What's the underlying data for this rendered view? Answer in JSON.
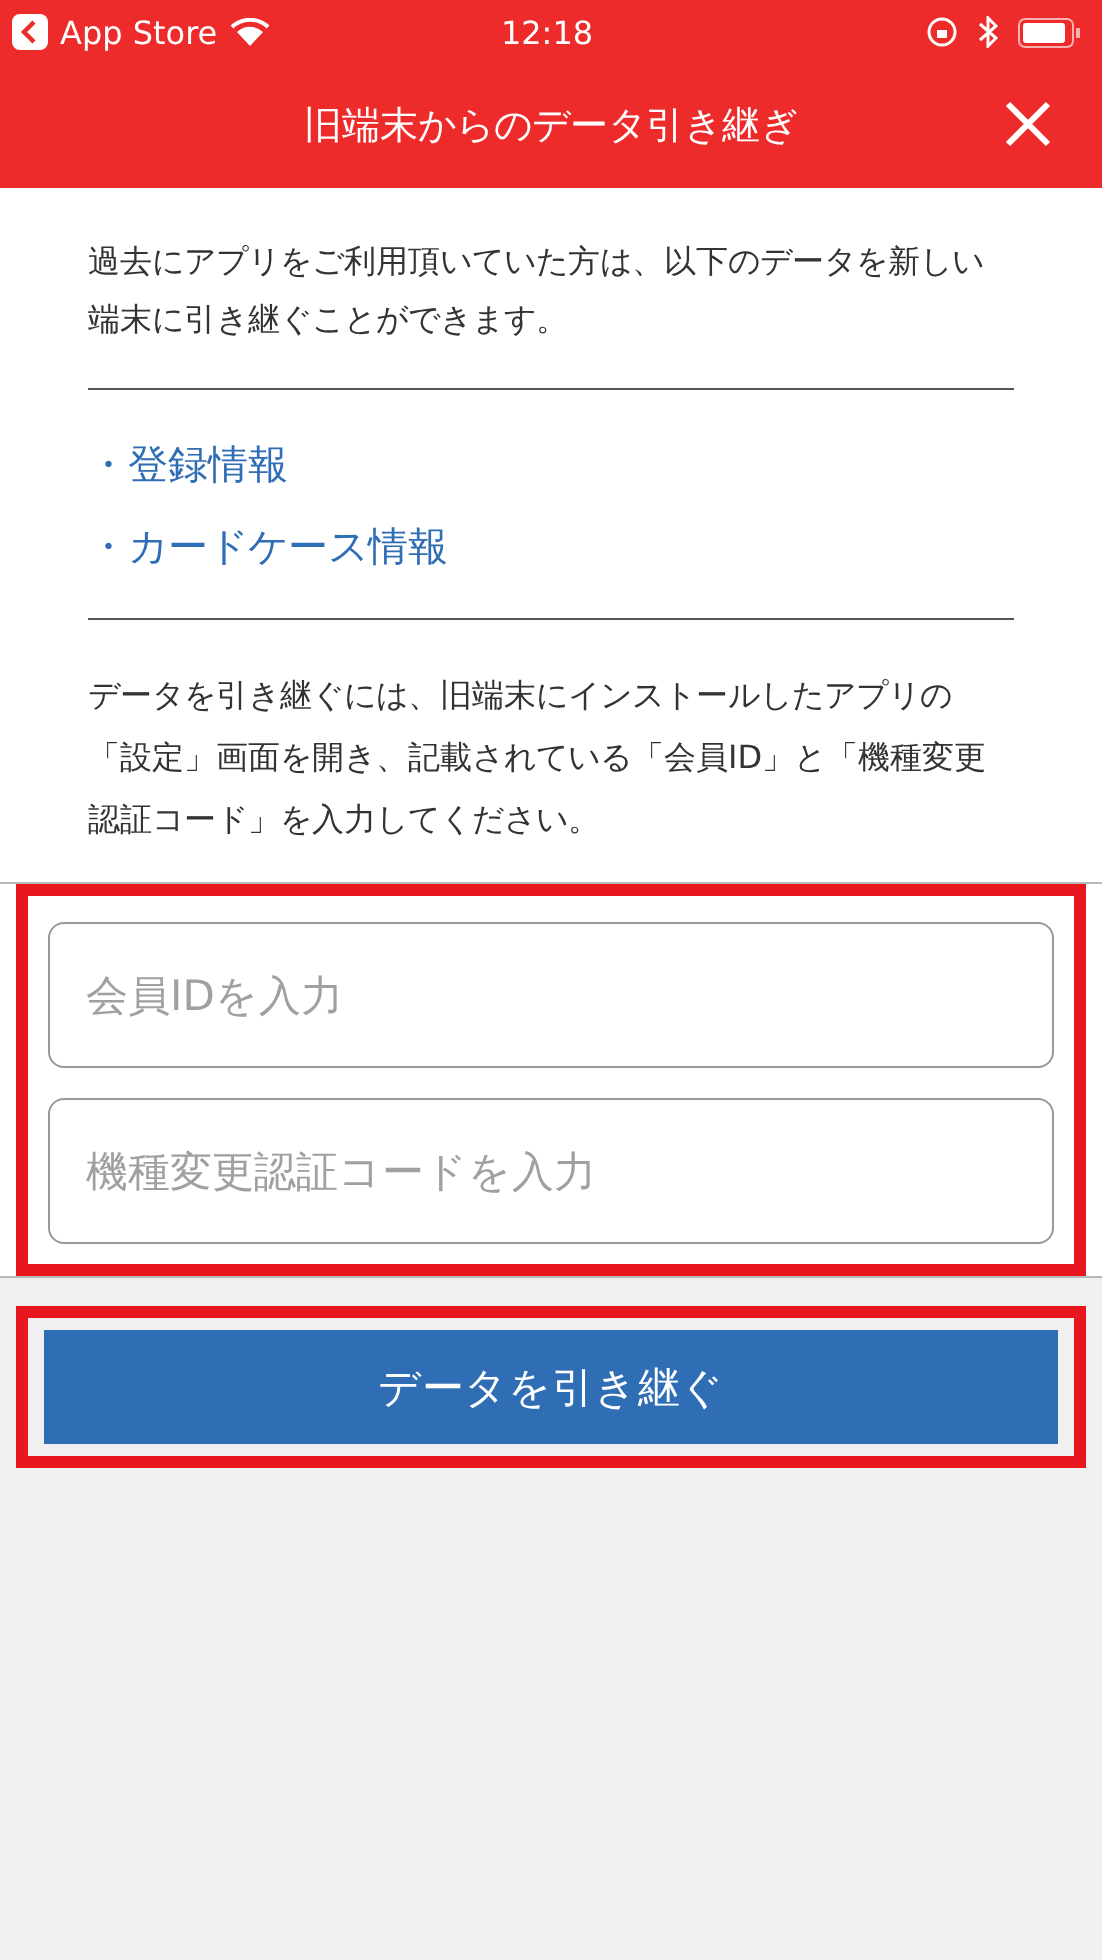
{
  "status_bar": {
    "back_label": "App Store",
    "time": "12:18"
  },
  "header": {
    "title": "旧端末からのデータ引き継ぎ"
  },
  "intro": "過去にアプリをご利用頂いていた方は、以下のデータを新しい端末に引き継ぐことができます。",
  "data_items": [
    {
      "label": "・登録情報"
    },
    {
      "label": "・カードケース情報"
    }
  ],
  "instructions": "データを引き継ぐには、旧端末にインストールしたアプリの「設定」画面を開き、記載されている「会員ID」と「機種変更認証コード」を入力してください。",
  "form": {
    "highlighted": true,
    "fields": [
      {
        "placeholder": "会員IDを入力"
      },
      {
        "placeholder": "機種変更認証コードを入力"
      }
    ]
  },
  "submit": {
    "highlighted": true,
    "label": "データを引き継ぐ"
  }
}
